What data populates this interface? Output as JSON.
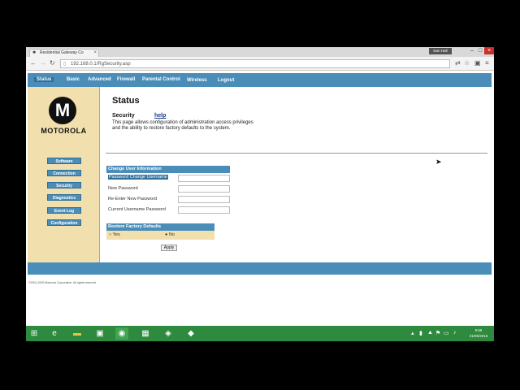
{
  "browser": {
    "tab_title": "Residential Gateway Co",
    "user_badge": "Dan Hall",
    "url": "192.168.0.1/RgSecurity.asp"
  },
  "topnav": {
    "items": [
      "Status",
      "Basic",
      "Advanced",
      "Firewall",
      "Parental Control",
      "Wireless",
      "Logout"
    ]
  },
  "sidebar": {
    "brand": "MOTOROLA",
    "logo_letter": "M",
    "items": [
      "Software",
      "Connection",
      "Security",
      "Diagnostics",
      "Event Log",
      "Configuration"
    ]
  },
  "content": {
    "title": "Status",
    "section": "Security",
    "help": "help",
    "description_line1": "This page allows configuration of administration access privileges",
    "description_line2": "and the ability to restore factory defaults to the system."
  },
  "change_user": {
    "header": "Change User Information",
    "fields": [
      "Password Change Username",
      "New Password",
      "Re-Enter New Password",
      "Current Username Password"
    ]
  },
  "restore": {
    "header": "Restore Factory Defaults",
    "yes": "Yes",
    "no": "No",
    "selected": "No",
    "apply": "Apply"
  },
  "footer": {
    "copyright": "©2001-2009 Motorola Corporation. All rights reserved."
  },
  "taskbar": {
    "time": "9:56",
    "date": "21/05/2016"
  }
}
